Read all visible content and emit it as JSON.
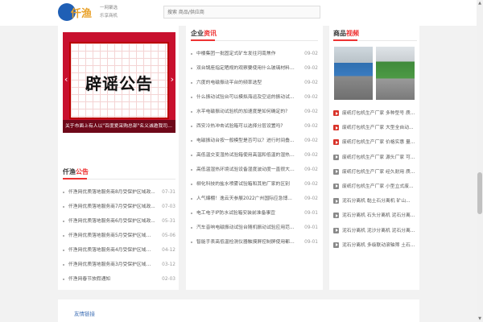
{
  "header": {
    "logo_text": "仟渔",
    "slogan_line1": "一网聚选",
    "slogan_line2": "乐享商机",
    "search_placeholder": "搜索 商品/供应商"
  },
  "banner": {
    "headline": "辟谣公告",
    "caption": "关于市面上有人以\"百度爱采购总部\"名义诚邀我司平台...",
    "prev": "‹",
    "next": "›"
  },
  "qianyu_section": {
    "title_prefix": "仟渔",
    "title_highlight": "公告",
    "items": [
      {
        "title": "仟渔网优质落地服务商8月受保护区域政...",
        "date": "07-31"
      },
      {
        "title": "仟渔网优质落地服务商7月受保护区域政...",
        "date": "07-03"
      },
      {
        "title": "仟渔网优质落地服务商6月受保护区域政...",
        "date": "05-31"
      },
      {
        "title": "仟渔网优质落地服务商5月受保护区域公告",
        "date": "05-06"
      },
      {
        "title": "仟渔网优质落地服务商4月受保护区域公告",
        "date": "04-12"
      },
      {
        "title": "仟渔网优质落地服务商3月受保护区域公告",
        "date": "03-12"
      },
      {
        "title": "仟渔网春节放假通知",
        "date": "02-03"
      }
    ]
  },
  "news_section": {
    "title_prefix": "企业",
    "title_highlight": "资讯",
    "items": [
      {
        "title": "中楼集团一批固定式矿车发往河南焦作",
        "date": "09-02"
      },
      {
        "title": "双台锅座指定晒规的观察要使用什么玻璃材料比...",
        "date": "09-02"
      },
      {
        "title": "六度的电磁振动平台的频率选型",
        "date": "09-02"
      },
      {
        "title": "什么振动试验台可以模拟海运及空运的振动试...",
        "date": "09-02"
      },
      {
        "title": "水平电磁振动试验机的加速度是如何确定的?",
        "date": "09-02"
      },
      {
        "title": "西安冷热冲击试验箱可以选择分层设置吗?",
        "date": "09-02"
      },
      {
        "title": "电磁振动台按一般模型是否可以？进行时间叠...",
        "date": "09-02"
      },
      {
        "title": "高低温交变湿热试验箱使用高温和低温的湿热结...",
        "date": "09-02"
      },
      {
        "title": "高低温湿热环境试验设备湿度波动度一直很大，如...",
        "date": "09-02"
      },
      {
        "title": "柳化科技的盐水喷雾试验箱和其他厂家的区别",
        "date": "09-02"
      },
      {
        "title": "人气爆棚！逸云天参展2022广州国际应急博...",
        "date": "09-02"
      },
      {
        "title": "电工电子IP防水试验箱安装前准备事宜",
        "date": "09-01"
      },
      {
        "title": "汽车音响电磁振动试验台随机振动试验应用范...",
        "date": "09-01"
      },
      {
        "title": "智能手表高低温检测仪器触摸屏控制屏使用都包...",
        "date": "09-01"
      }
    ]
  },
  "product_section": {
    "title_prefix": "商品",
    "title_highlight": "视频",
    "items": [
      {
        "title": "废纸打包机生产厂家 多种型号 质...",
        "icon": "red"
      },
      {
        "title": "废纸打包机生产厂家 大型全自动...",
        "icon": "red"
      },
      {
        "title": "废纸打包机生产厂家 价格实惠 量...",
        "icon": "red"
      },
      {
        "title": "废纸打包机生产厂家 源头厂家 可...",
        "icon": "gray"
      },
      {
        "title": "废纸打包机生产厂家 经久耐用 质...",
        "icon": "gray"
      },
      {
        "title": "废纸打包机生产厂家 小型立式废...",
        "icon": "gray"
      },
      {
        "title": "泥石分离机 黏土石分离机 矿山...",
        "icon": "gray"
      },
      {
        "title": "泥石分离机 石头分离机 泥石分离...",
        "icon": "gray"
      },
      {
        "title": "泥石分离机 泥沙分离机 泥石分离...",
        "icon": "gray"
      },
      {
        "title": "泥石分离机 多级联动滚轴筛 土石...",
        "icon": "gray"
      }
    ]
  },
  "friend_links": {
    "title": "友情链接"
  },
  "colors": {
    "accent": "#ee3333",
    "link_blue": "#3c6eb4",
    "logo_blue": "#1f5fb5",
    "logo_gold": "#e9a22b"
  }
}
